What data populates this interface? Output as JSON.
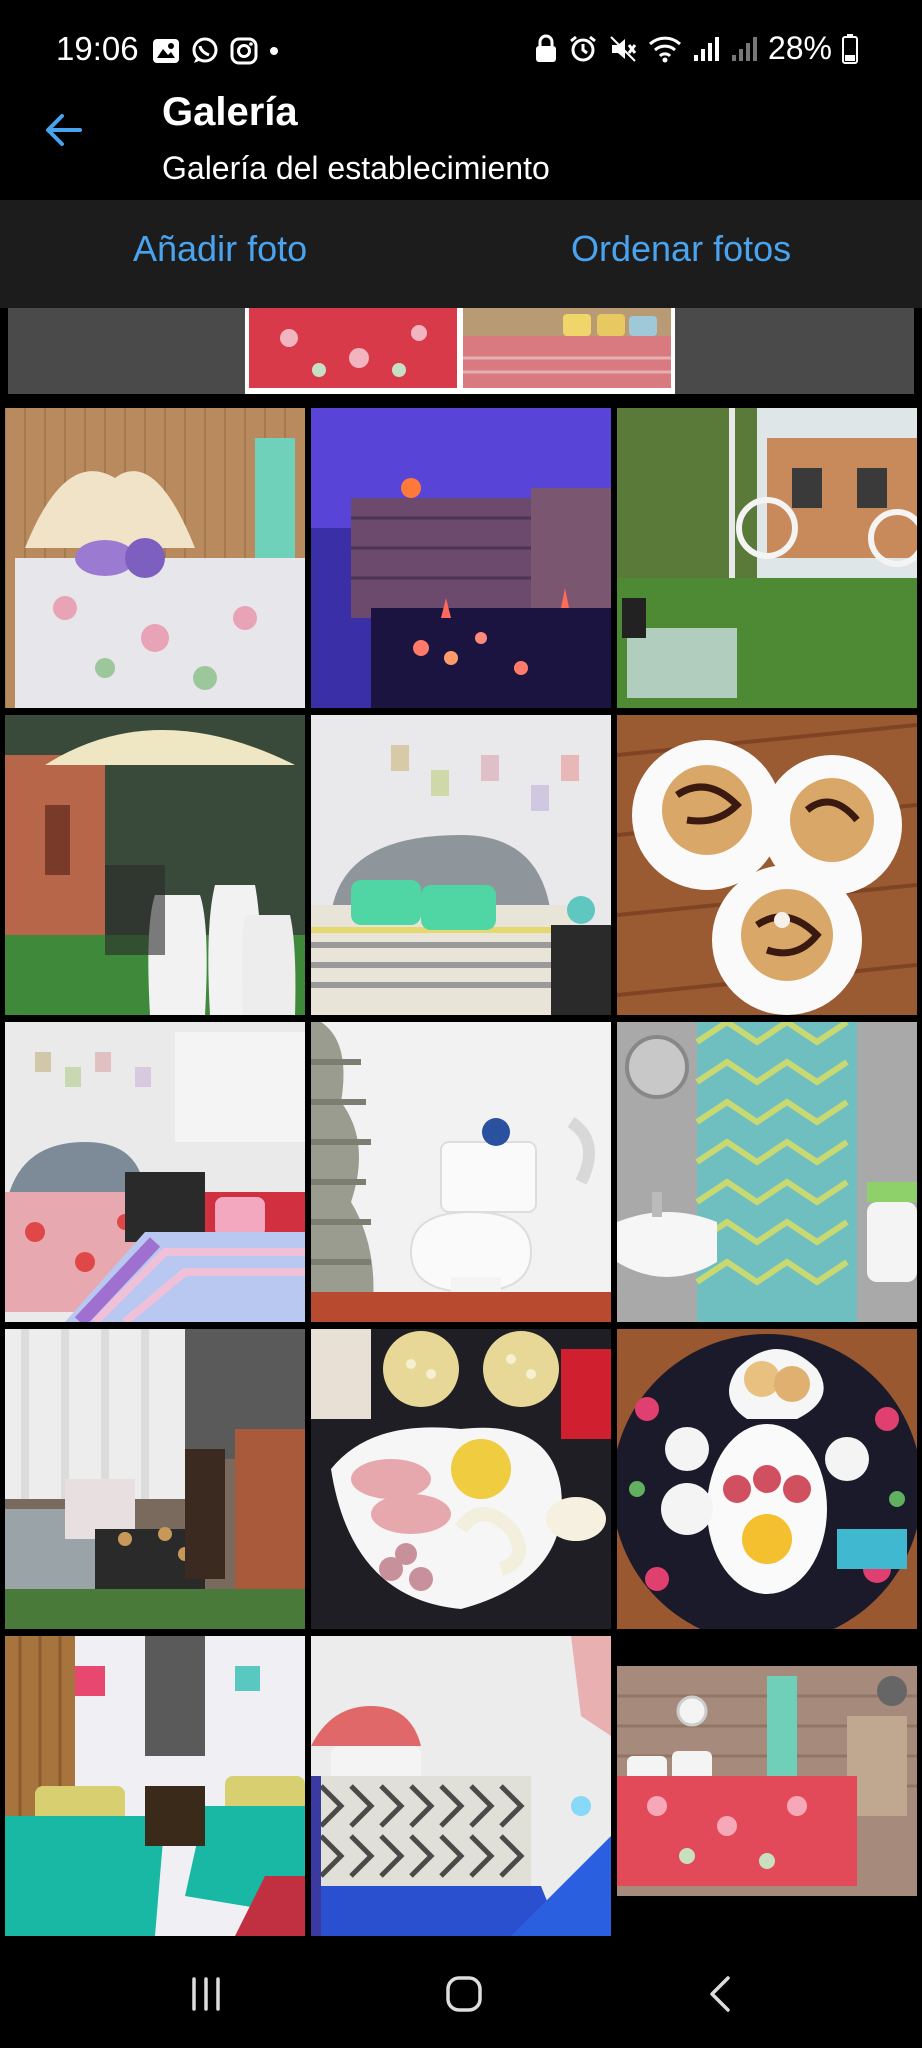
{
  "status_bar": {
    "time": "19:06",
    "battery": "28%",
    "left_icons": [
      "gallery-icon",
      "whatsapp-icon",
      "instagram-icon",
      "dot-icon"
    ],
    "right_icons": [
      "lock-icon",
      "alarm-icon",
      "mute-icon",
      "wifi-icon",
      "signal-icon",
      "signal-icon",
      "battery-icon"
    ]
  },
  "header": {
    "title": "Galería",
    "subtitle": "Galería del establecimiento",
    "back_icon": "arrow-left-icon"
  },
  "actions": {
    "add_label": "Añadir foto",
    "sort_label": "Ordenar fotos"
  },
  "colors": {
    "accent": "#4aa3ef",
    "background": "#000000",
    "action_bar": "#1c1c1c"
  },
  "gallery": {
    "photos": [
      {
        "subject": "bedroom-floral-bed"
      },
      {
        "subject": "hot-tub-candles"
      },
      {
        "subject": "garden-hammock-chairs"
      },
      {
        "subject": "patio-umbrella-chairs"
      },
      {
        "subject": "bedroom-green-pillows"
      },
      {
        "subject": "waffles-plates"
      },
      {
        "subject": "bedroom-colorful-rug"
      },
      {
        "subject": "bathroom-toilet"
      },
      {
        "subject": "bathroom-sink-curtain"
      },
      {
        "subject": "living-room-sofa"
      },
      {
        "subject": "snack-platter"
      },
      {
        "subject": "breakfast-tray"
      },
      {
        "subject": "twin-beds-teal"
      },
      {
        "subject": "bedroom-patterned-bed"
      },
      {
        "subject": "bedroom-red-bedspread"
      }
    ]
  },
  "nav_bar": {
    "icons": [
      "recent-apps-icon",
      "home-icon",
      "back-icon"
    ]
  }
}
